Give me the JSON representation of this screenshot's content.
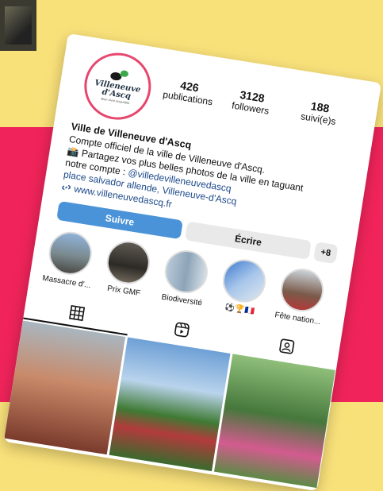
{
  "profile": {
    "logo_text": "Villeneuve d'Ascq",
    "logo_tagline": "Bien vivre ensemble",
    "name": "Ville de Villeneuve d'Ascq",
    "stats": [
      {
        "value": "426",
        "label": "publications"
      },
      {
        "value": "3128",
        "label": "followers"
      },
      {
        "value": "188",
        "label": "suivi(e)s"
      }
    ],
    "bio_lines": [
      "Compte officiel de la ville de Villeneuve d'Ascq.",
      "📸 Partagez vos plus belles photos de la ville en taguant",
      "notre compte : "
    ],
    "bio_mention": "@villedevilleneuvedascq",
    "address": "place salvador allende, Villeneuve-d'Ascq",
    "website": "www.villeneuvedascq.fr"
  },
  "actions": {
    "follow": "Suivre",
    "message": "Écrire",
    "add": "+8"
  },
  "highlights": [
    {
      "label": "Massacre d'..."
    },
    {
      "label": "Prix GMF"
    },
    {
      "label": "Biodiversité"
    },
    {
      "label": "⚽🏆🇫🇷"
    },
    {
      "label": "Fête nation..."
    }
  ],
  "colors": {
    "background_top": "#f9e17a",
    "background_bottom": "#f0245a",
    "follow_button": "#4b93d8",
    "link": "#1d4a8b"
  },
  "icons": {
    "grid_tab": "grid-icon",
    "reels_tab": "reels-icon",
    "tagged_tab": "tagged-icon",
    "website": "link-icon"
  }
}
